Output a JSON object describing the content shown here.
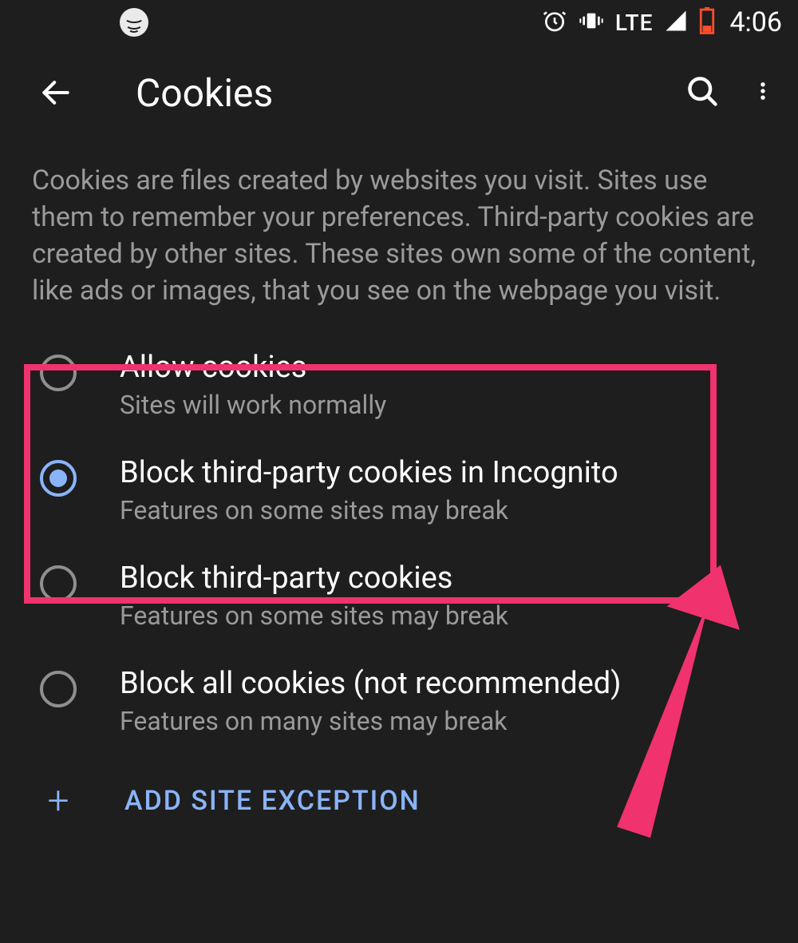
{
  "statusbar": {
    "network": "LTE",
    "time": "4:06"
  },
  "appbar": {
    "title": "Cookies"
  },
  "description": "Cookies are files created by websites you visit. Sites use them to remember your preferences. Third-party cookies are created by other sites. These sites own some of the content, like ads or images, that you see on the webpage you visit.",
  "options": [
    {
      "title": "Allow cookies",
      "subtitle": "Sites will work normally",
      "selected": false
    },
    {
      "title": "Block third-party cookies in Incognito",
      "subtitle": "Features on some sites may break",
      "selected": true
    },
    {
      "title": "Block third-party cookies",
      "subtitle": "Features on some sites may break",
      "selected": false
    },
    {
      "title": "Block all cookies (not recommended)",
      "subtitle": "Features on many sites may break",
      "selected": false
    }
  ],
  "add_exception": {
    "label": "ADD SITE EXCEPTION"
  },
  "annotation": {
    "highlight": "options-0-1",
    "arrow_color": "#f0326e"
  }
}
